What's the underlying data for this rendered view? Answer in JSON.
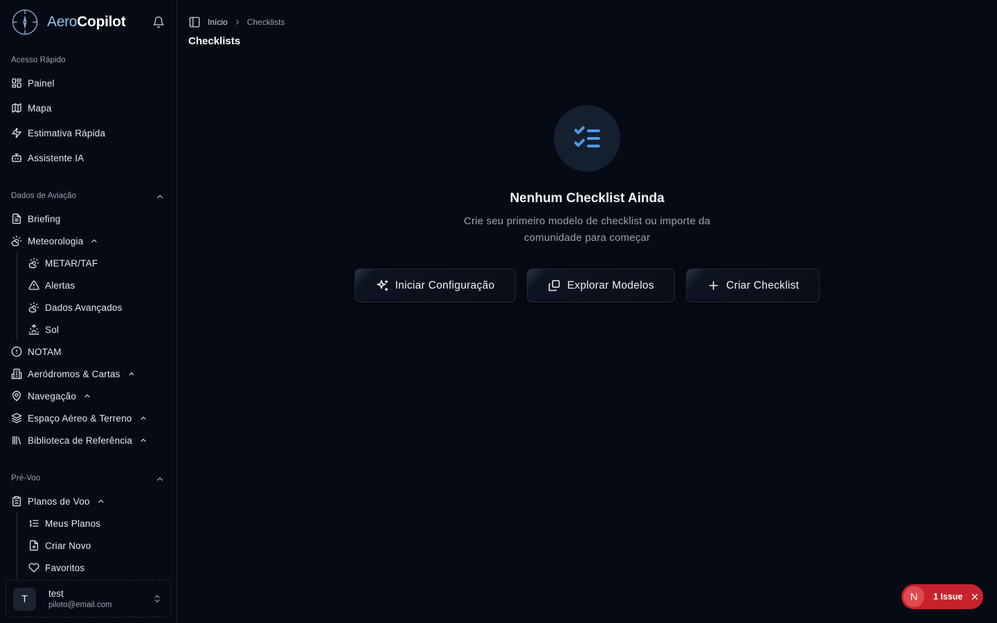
{
  "app": {
    "name_part1": "Aero",
    "name_part2": "Copilot"
  },
  "sidebar": {
    "quick_access": {
      "label": "Acesso Rápido",
      "items": [
        {
          "label": "Painel",
          "icon": "grid-icon"
        },
        {
          "label": "Mapa",
          "icon": "map-icon"
        },
        {
          "label": "Estimativa Rápida",
          "icon": "zap-icon"
        },
        {
          "label": "Assistente IA",
          "icon": "bot-icon"
        }
      ]
    },
    "aviation_data": {
      "label": "Dados de Aviação",
      "briefing": "Briefing",
      "meteorologia": "Meteorologia",
      "meteo_sub": [
        "METAR/TAF",
        "Alertas",
        "Dados Avançados",
        "Sol"
      ],
      "notam": "NOTAM",
      "aerodromos": "Aeródromos & Cartas",
      "navegacao": "Navegação",
      "espaco": "Espaço Aéreo & Terreno",
      "biblioteca": "Biblioteca de Referência"
    },
    "preflight": {
      "label": "Pré-Voo",
      "planos": "Planos de Voo",
      "planos_sub": [
        "Meus Planos",
        "Criar Novo",
        "Favoritos"
      ]
    },
    "user": {
      "initial": "T",
      "name": "test",
      "email": "piloto@email.com"
    }
  },
  "breadcrumb": {
    "home": "Início",
    "current": "Checklists"
  },
  "page": {
    "title": "Checklists"
  },
  "empty_state": {
    "title": "Nenhum Checklist Ainda",
    "desc_line1": "Crie seu primeiro modelo de checklist ou importe da",
    "desc_line2": "comunidade para começar"
  },
  "actions": {
    "start_setup": "Iniciar Configuração",
    "explore": "Explorar Modelos",
    "create": "Criar Checklist"
  },
  "issues": {
    "badge_letter": "N",
    "label": "1 Issue"
  },
  "colors": {
    "background": "#060a14",
    "accent": "#4f9be8",
    "issue": "#c8232c"
  }
}
